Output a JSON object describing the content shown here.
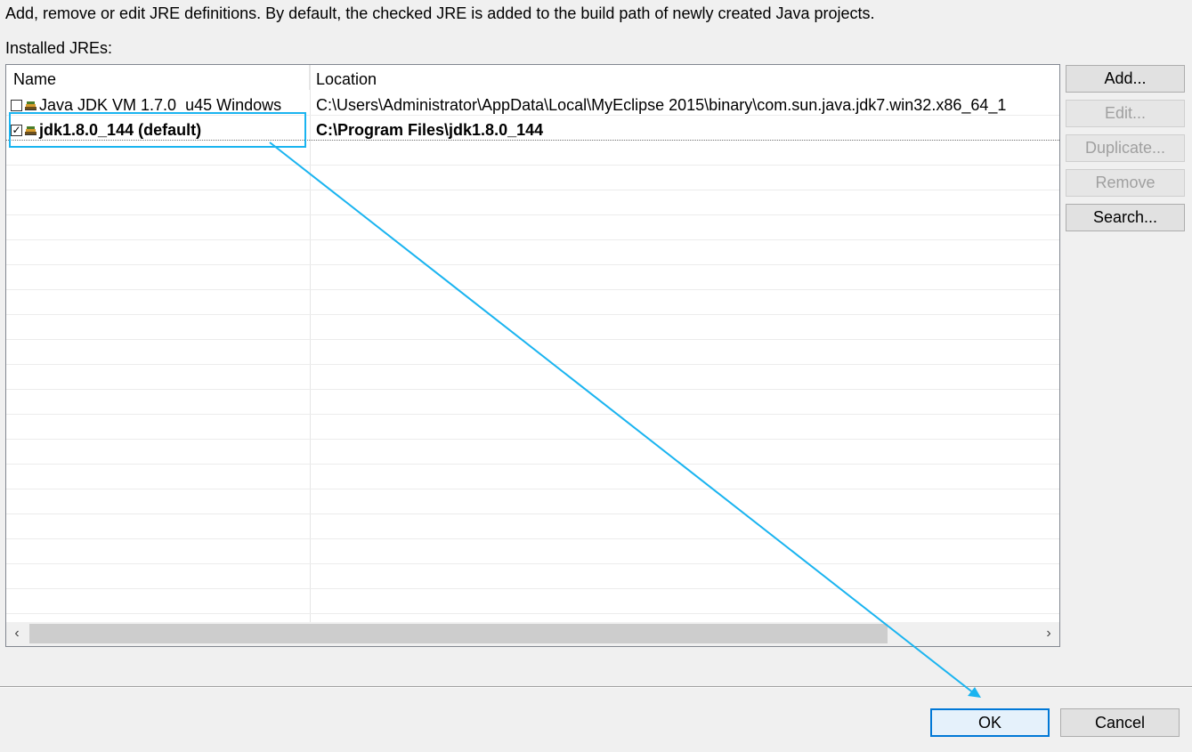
{
  "description": "Add, remove or edit JRE definitions. By default, the checked JRE is added to the build path of newly created Java projects.",
  "installed_label": "Installed JREs:",
  "table": {
    "columns": [
      "Name",
      "Location"
    ],
    "rows": [
      {
        "name": "Java JDK VM 1.7.0_u45 Windows",
        "location": "C:\\Users\\Administrator\\AppData\\Local\\MyEclipse 2015\\binary\\com.sun.java.jdk7.win32.x86_64_1",
        "checked": false,
        "check_glyph": ""
      },
      {
        "name": "jdk1.8.0_144 (default)",
        "location": "C:\\Program Files\\jdk1.8.0_144",
        "checked": true,
        "check_glyph": "✓"
      }
    ]
  },
  "scrollbar": {
    "left_arrow": "‹",
    "right_arrow": "›"
  },
  "side_buttons": {
    "add": "Add...",
    "edit": "Edit...",
    "duplicate": "Duplicate...",
    "remove": "Remove",
    "search": "Search..."
  },
  "dialog_buttons": {
    "ok": "OK",
    "cancel": "Cancel"
  },
  "colors": {
    "annotation": "#1ab4f0",
    "focus": "#0078d7"
  }
}
